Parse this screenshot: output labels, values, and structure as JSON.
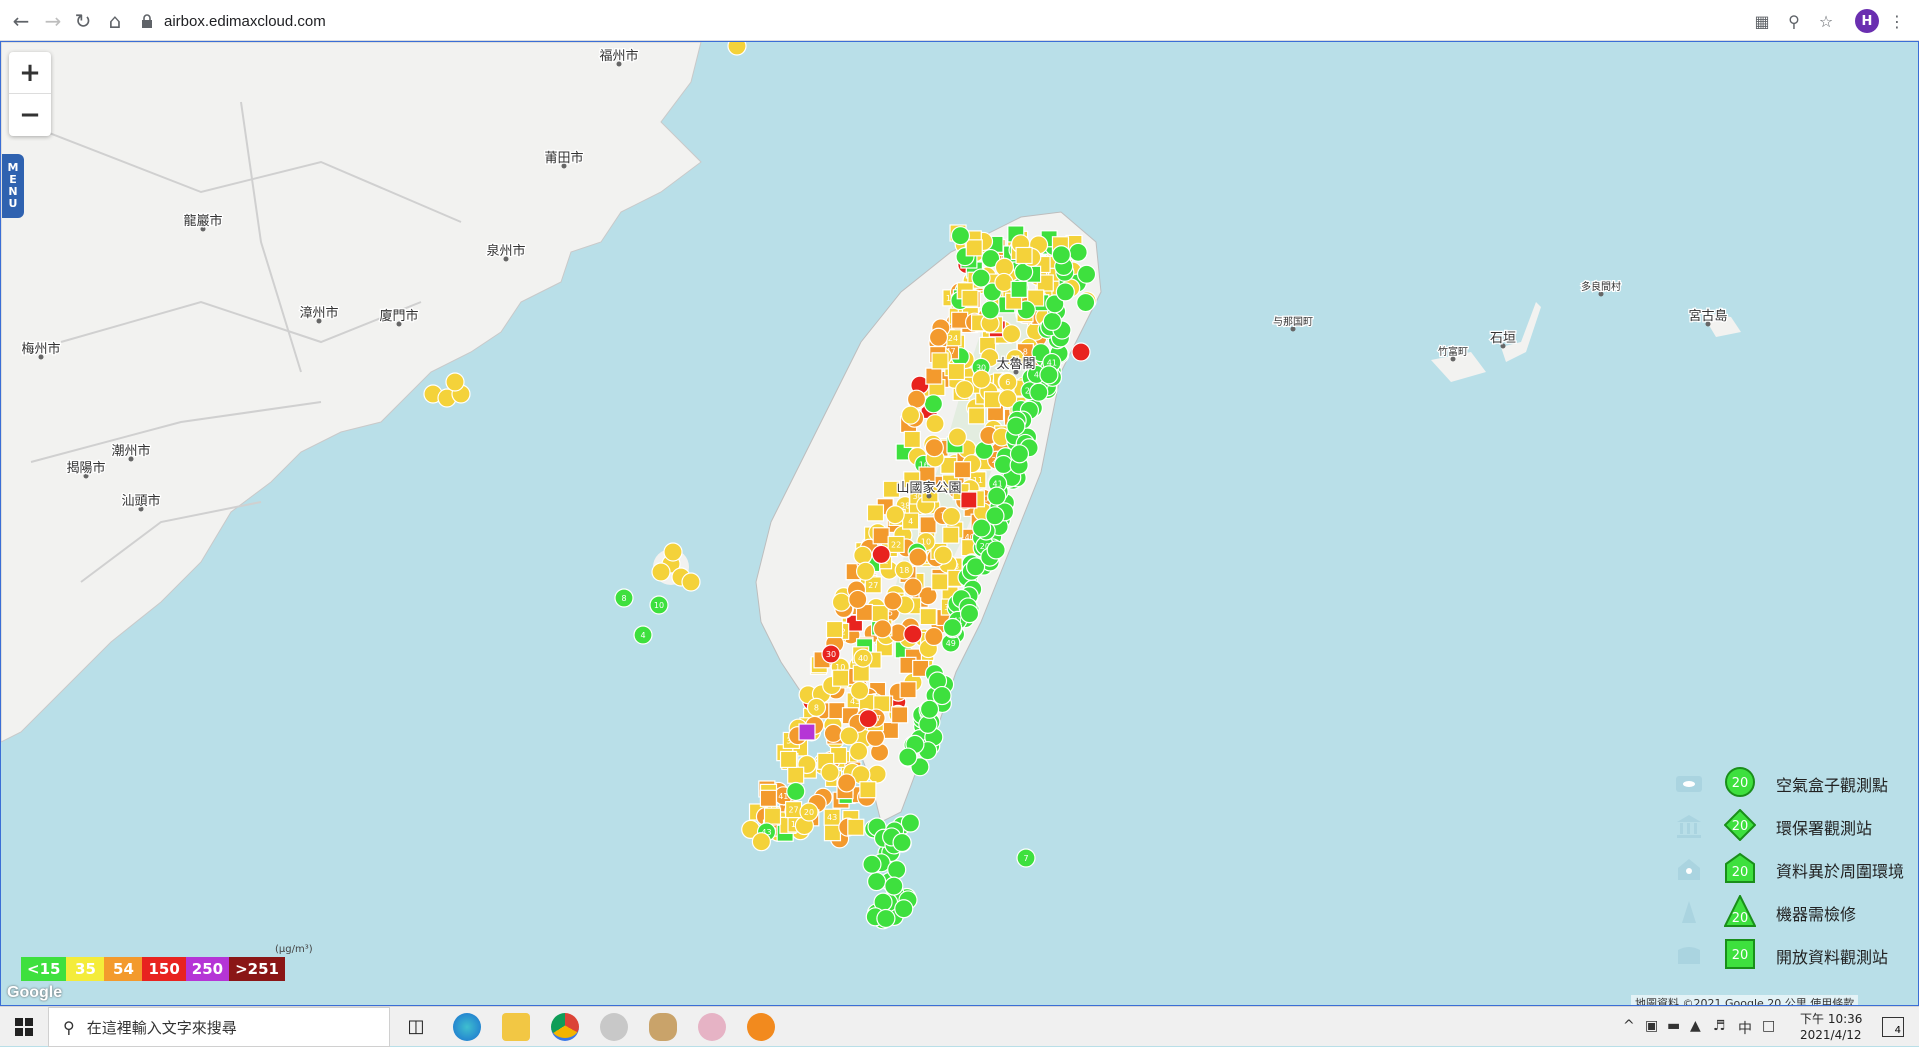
{
  "browser": {
    "url": "airbox.edimaxcloud.com",
    "profile_initial": "H"
  },
  "map": {
    "zoom_in_label": "+",
    "zoom_out_label": "−",
    "menu_label": [
      "M",
      "E",
      "N",
      "U"
    ],
    "place_labels": [
      {
        "id": "fuzhou",
        "text": "福州市"
      },
      {
        "id": "putian",
        "text": "莆田市"
      },
      {
        "id": "quanzhou",
        "text": "泉州市"
      },
      {
        "id": "longyan",
        "text": "龍巖市"
      },
      {
        "id": "zhangzhou",
        "text": "漳州市"
      },
      {
        "id": "xiamen",
        "text": "廈門市"
      },
      {
        "id": "meizhou",
        "text": "梅州市"
      },
      {
        "id": "chaozhou",
        "text": "潮州市"
      },
      {
        "id": "jieyang",
        "text": "揭陽市"
      },
      {
        "id": "shantou",
        "text": "汕頭市"
      },
      {
        "id": "miyako",
        "text": "宮古島"
      },
      {
        "id": "ishigaki",
        "text": "石垣"
      },
      {
        "id": "taketomi",
        "text": "竹富町"
      },
      {
        "id": "yonaguni",
        "text": "与那国町"
      },
      {
        "id": "tarama",
        "text": "多良間村"
      },
      {
        "id": "taroko",
        "text": "太魯閣"
      },
      {
        "id": "yushan",
        "text": "山國家公園"
      }
    ],
    "markers_visible_values": [
      "30",
      "20",
      "40",
      "41",
      "43",
      "47",
      "38",
      "12",
      "14",
      "49",
      "27",
      "8",
      "6",
      "4",
      "10",
      "22",
      "16",
      "11",
      "5",
      "7",
      "3",
      "18",
      "24",
      "37"
    ],
    "pm_scale": [
      {
        "label": "<15",
        "color": "#3ee03e"
      },
      {
        "label": "35",
        "color": "#f4ec3a"
      },
      {
        "label": "54",
        "color": "#f39a2d"
      },
      {
        "label": "150",
        "color": "#e8231f"
      },
      {
        "label": "250",
        "color": "#b535d6"
      },
      {
        "label": ">251",
        "color": "#8a1616"
      }
    ],
    "pm_unit": "(μg/m³)",
    "google_logo": "Google",
    "attribution": "地圖資料 ©2021 Google   20 公里        使用條款"
  },
  "legend": {
    "sample_value": "20",
    "items": [
      {
        "label": "空氣盒子觀測點"
      },
      {
        "label": "環保署觀測站"
      },
      {
        "label": "資料異於周圍環境"
      },
      {
        "label": "機器需檢修"
      },
      {
        "label": "開放資料觀測站"
      }
    ]
  },
  "taskbar": {
    "search_placeholder": "在這裡輸入文字來搜尋",
    "clock_time": "下午 10:36",
    "clock_date": "2021/4/12",
    "ime": "中",
    "notification_count": "4"
  },
  "colors": {
    "sea": "#b9dfe8",
    "land": "#f1f1ef",
    "green": "#3ee03e",
    "yellow": "#f4d23a",
    "orange": "#f39a2d",
    "red": "#e8231f",
    "purple": "#b535d6"
  }
}
